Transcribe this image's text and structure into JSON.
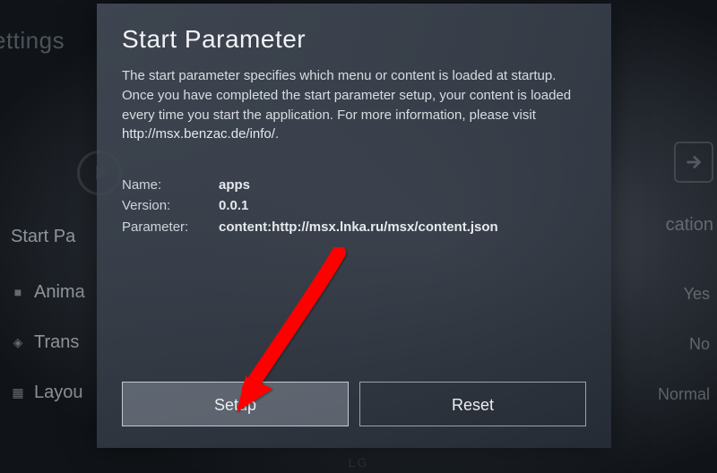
{
  "background": {
    "settings_label": "ettings",
    "start_pa": "Start Pa",
    "items": [
      {
        "icon": "■",
        "label": "Anima"
      },
      {
        "icon": "◈",
        "label": "Trans"
      },
      {
        "icon": "▦",
        "label": "Layou"
      }
    ],
    "right_labels": [
      "Yes",
      "No",
      "Normal"
    ],
    "cation": "cation",
    "logo": "LG"
  },
  "dialog": {
    "title": "Start Parameter",
    "description_1": "The start parameter specifies which menu or content is loaded at startup. Once you have completed the start parameter setup, your content is loaded every time you start the application. For more information, please visit ",
    "description_link": "http://msx.benzac.de/info/",
    "description_2": ".",
    "info": {
      "name_label": "Name:",
      "name_value": "apps",
      "version_label": "Version:",
      "version_value": "0.0.1",
      "parameter_label": "Parameter:",
      "parameter_value": "content:http://msx.lnka.ru/msx/content.json"
    },
    "buttons": {
      "setup": "Setup",
      "reset": "Reset"
    }
  }
}
